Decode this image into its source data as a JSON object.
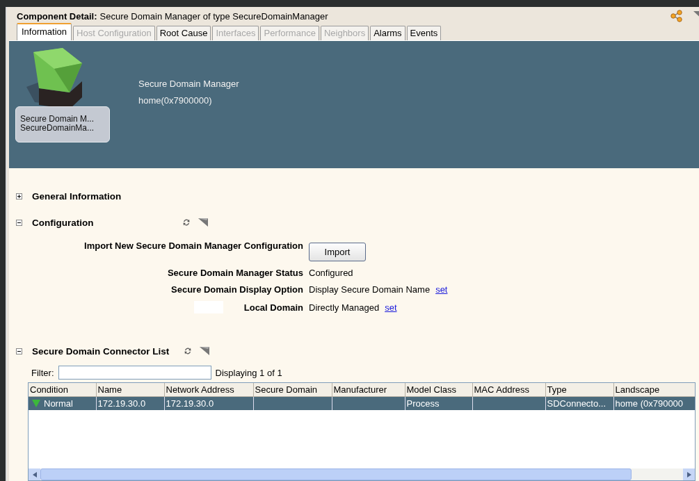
{
  "header": {
    "label": "Component Detail:",
    "text": "Secure Domain Manager of type SecureDomainManager"
  },
  "tabs": [
    {
      "label": "Information",
      "selected": true,
      "disabled": false
    },
    {
      "label": "Host Configuration",
      "selected": false,
      "disabled": true
    },
    {
      "label": "Root Cause",
      "selected": false,
      "disabled": false
    },
    {
      "label": "Interfaces",
      "selected": false,
      "disabled": true
    },
    {
      "label": "Performance",
      "selected": false,
      "disabled": true
    },
    {
      "label": "Neighbors",
      "selected": false,
      "disabled": true
    },
    {
      "label": "Alarms",
      "selected": false,
      "disabled": false
    },
    {
      "label": "Events",
      "selected": false,
      "disabled": false
    }
  ],
  "banner": {
    "tile_lines": [
      "Secure Domain M...",
      "SecureDomainMa..."
    ],
    "name": "Secure Domain Manager",
    "address": "home(0x7900000)"
  },
  "sections": [
    {
      "kind": "plain",
      "title": "General Information",
      "expanded": false
    },
    {
      "kind": "form",
      "title": "Configuration",
      "expanded": true,
      "rows": [
        {
          "kind": "button",
          "label": "Import New Secure Domain Manager Configuration",
          "button": "Import"
        },
        {
          "kind": "value",
          "label": "Secure Domain Manager Status",
          "value": "Configured"
        },
        {
          "kind": "value",
          "label": "Secure Domain Display Option",
          "value": "Display Secure Domain Name",
          "link": "set"
        },
        {
          "kind": "value",
          "label": "Local Domain",
          "value": "Directly Managed",
          "link": "set",
          "blank_box": true
        }
      ]
    },
    {
      "kind": "table",
      "title": "Secure Domain Connector List",
      "expanded": true,
      "filter_label": "Filter:",
      "count": "Displaying 1 of 1",
      "columns": [
        "Condition",
        "Name",
        "Network Address",
        "Secure Domain",
        "Manufacturer",
        "Model Class",
        "MAC Address",
        "Type",
        "Landscape"
      ],
      "rows": [
        {
          "selected": true,
          "color": "#3cb83c",
          "cells": [
            "Normal",
            "172.19.30.0",
            "172.19.30.0",
            "",
            "",
            "Process",
            "",
            "SDConnecto...",
            "home (0x790000"
          ]
        }
      ]
    }
  ]
}
